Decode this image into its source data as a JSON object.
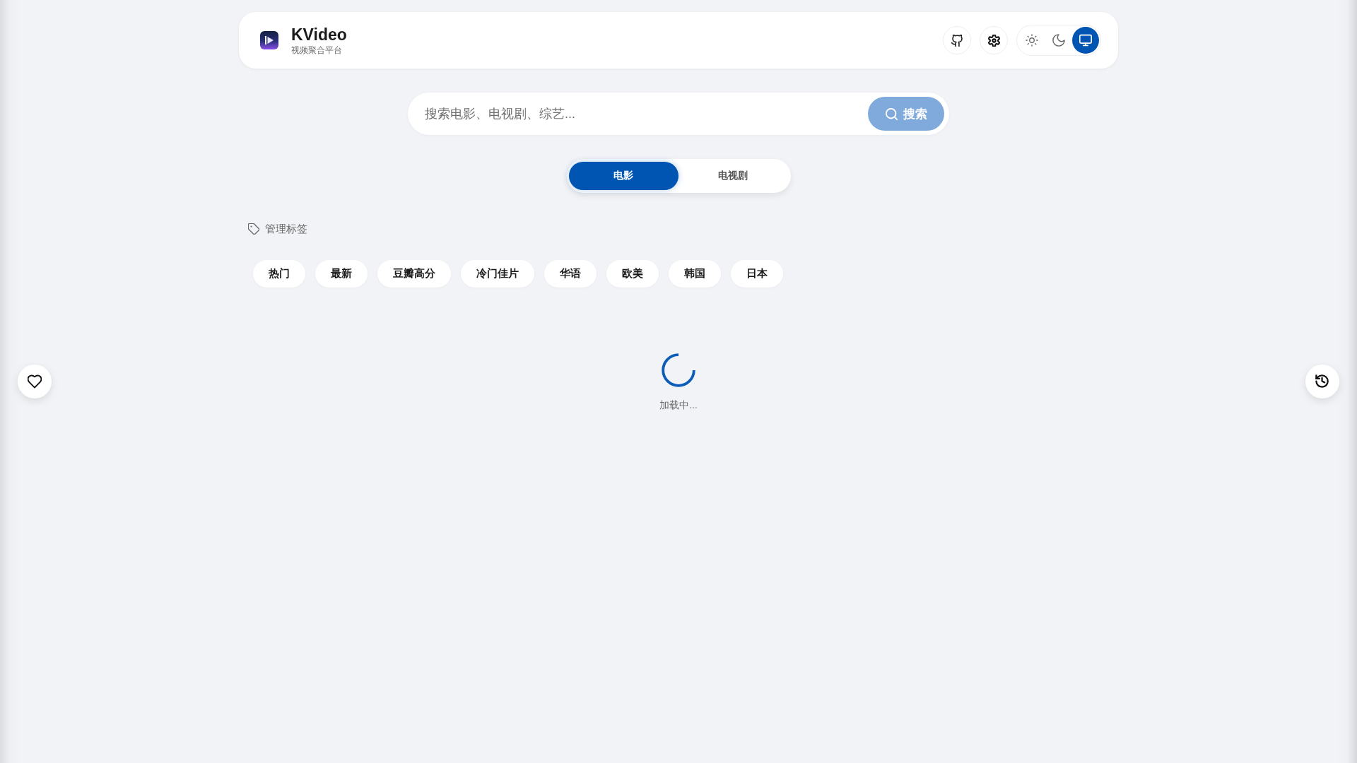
{
  "header": {
    "title": "KVideo",
    "subtitle": "视频聚合平台",
    "theme_options": [
      {
        "kind": "light",
        "selected": false
      },
      {
        "kind": "dark",
        "selected": false
      },
      {
        "kind": "system",
        "selected": true
      }
    ]
  },
  "search": {
    "placeholder": "搜索电影、电视剧、综艺...",
    "button": {
      "label": "搜索",
      "disabled": true
    }
  },
  "tabs": [
    {
      "label": "电影",
      "selected": true
    },
    {
      "label": "电视剧",
      "selected": false
    }
  ],
  "tags": {
    "manage_label": "管理标签",
    "items": [
      {
        "label": "热门",
        "selected": false
      },
      {
        "label": "最新",
        "selected": false
      },
      {
        "label": "豆瓣高分",
        "selected": false
      },
      {
        "label": "冷门佳片",
        "selected": false
      },
      {
        "label": "华语",
        "selected": false
      },
      {
        "label": "欧美",
        "selected": false
      },
      {
        "label": "韩国",
        "selected": false
      },
      {
        "label": "日本",
        "selected": false
      }
    ]
  },
  "loading": {
    "text": "加载中..."
  }
}
